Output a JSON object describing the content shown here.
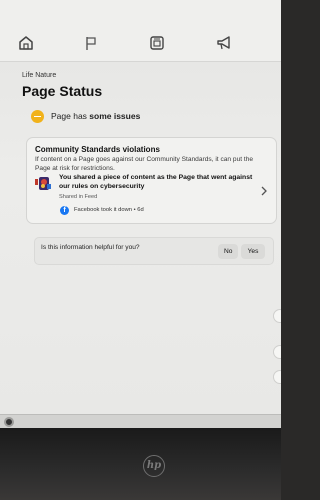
{
  "breadcrumb": "Life Nature",
  "page_title": "Page Status",
  "status": {
    "prefix": "Page has ",
    "emphasis": "some issues",
    "icon": "warning-dot-icon",
    "color": "#f1b21a"
  },
  "violations": {
    "title": "Community Standards violations",
    "description": "If content on a Page goes against our Community Standards, it can put the Page at risk for restrictions.",
    "item": {
      "text": "You shared a piece of content as the Page that went against our rules on cybersecurity",
      "subtext": "Shared in Feed",
      "action": "Facebook took it down • 6d"
    }
  },
  "feedback": {
    "question": "Is this information helpful for you?",
    "no_label": "No",
    "yes_label": "Yes"
  },
  "brand": {
    "facebook_blue": "#1877f2",
    "logo": "hp"
  }
}
